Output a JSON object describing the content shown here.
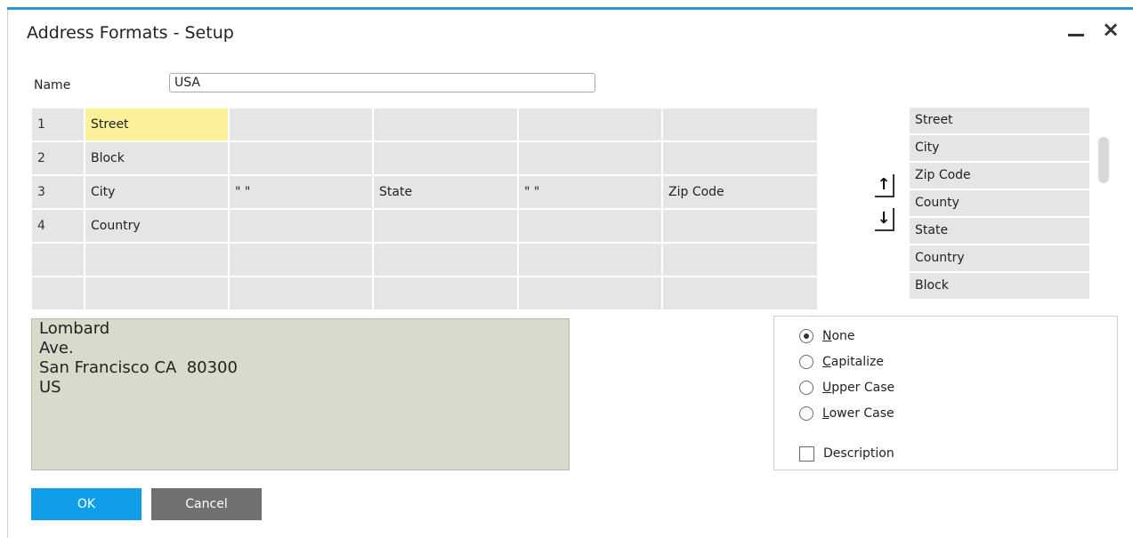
{
  "window": {
    "title": "Address Formats - Setup"
  },
  "colors": {
    "accent": "#2b95d6",
    "ok_button": "#0f9ee7",
    "cancel_button": "#707070",
    "selected_cell": "#fbf19b",
    "preview_bg": "#d9d9cc"
  },
  "name": {
    "label": "Name",
    "value": "USA"
  },
  "grid": {
    "rows": [
      {
        "num": "1",
        "cells": [
          "Street",
          "",
          "",
          "",
          ""
        ]
      },
      {
        "num": "2",
        "cells": [
          "Block",
          "",
          "",
          "",
          ""
        ]
      },
      {
        "num": "3",
        "cells": [
          "City",
          "\" \"",
          "State",
          "\" \"",
          "Zip Code"
        ]
      },
      {
        "num": "4",
        "cells": [
          "Country",
          "",
          "",
          "",
          ""
        ]
      },
      {
        "num": "",
        "cells": [
          "",
          "",
          "",
          "",
          ""
        ]
      },
      {
        "num": "",
        "cells": [
          "",
          "",
          "",
          "",
          ""
        ]
      }
    ],
    "selected_cell": "Street"
  },
  "move_buttons": {
    "up_icon": "arrow-up-icon",
    "down_icon": "arrow-down-icon"
  },
  "fields": [
    "Street",
    "City",
    "Zip Code",
    "County",
    "State",
    "Country",
    "Block"
  ],
  "preview": {
    "lines": [
      "Lombard",
      "Ave.",
      "San Francisco CA  80300",
      "US"
    ]
  },
  "options": {
    "radios": [
      {
        "label": "None",
        "checked": true
      },
      {
        "label": "Capitalize",
        "checked": false
      },
      {
        "label": "Upper Case",
        "checked": false
      },
      {
        "label": "Lower Case",
        "checked": false
      }
    ],
    "description": {
      "label": "Description",
      "checked": false
    }
  },
  "buttons": {
    "ok": "OK",
    "cancel": "Cancel"
  }
}
